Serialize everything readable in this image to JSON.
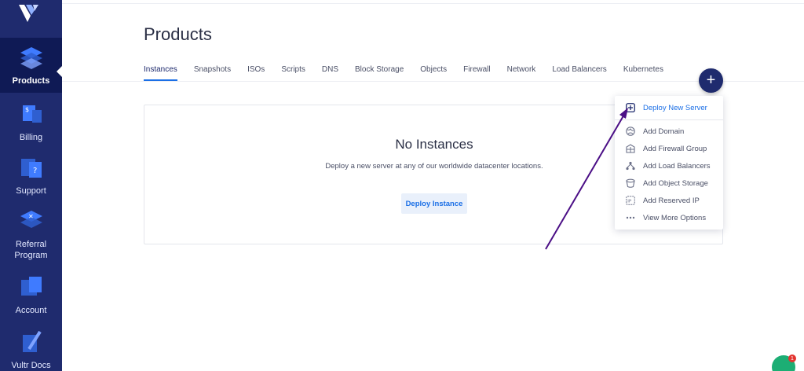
{
  "sidebar": {
    "items": [
      {
        "label": "Products",
        "icon": "products-icon",
        "active": true
      },
      {
        "label": "Billing",
        "icon": "billing-icon"
      },
      {
        "label": "Support",
        "icon": "support-icon"
      },
      {
        "label": "Referral\nProgram",
        "icon": "referral-icon"
      },
      {
        "label": "Account",
        "icon": "account-icon"
      },
      {
        "label": "Vultr Docs",
        "icon": "docs-icon"
      }
    ]
  },
  "page": {
    "title": "Products"
  },
  "tabs": [
    "Instances",
    "Snapshots",
    "ISOs",
    "Scripts",
    "DNS",
    "Block Storage",
    "Objects",
    "Firewall",
    "Network",
    "Load Balancers",
    "Kubernetes"
  ],
  "fab": {
    "label": "+"
  },
  "empty_state": {
    "title": "No Instances",
    "description": "Deploy a new server at any of our worldwide datacenter locations.",
    "button": "Deploy Instance"
  },
  "menu": {
    "items": [
      {
        "label": "Deploy New Server",
        "icon": "plus-square-icon"
      },
      {
        "label": "Add Domain",
        "icon": "globe-icon"
      },
      {
        "label": "Add Firewall Group",
        "icon": "firewall-icon"
      },
      {
        "label": "Add Load Balancers",
        "icon": "load-balancer-icon"
      },
      {
        "label": "Add Object Storage",
        "icon": "bucket-icon"
      },
      {
        "label": "Add Reserved IP",
        "icon": "ip-icon"
      },
      {
        "label": "View More Options",
        "icon": "more-dots-icon"
      }
    ]
  },
  "chat": {
    "badge": "1"
  },
  "colors": {
    "sidebar": "#1f2b6e",
    "accent": "#1b6fe6",
    "arrow": "#4b0f86",
    "chat": "#1cae74"
  }
}
